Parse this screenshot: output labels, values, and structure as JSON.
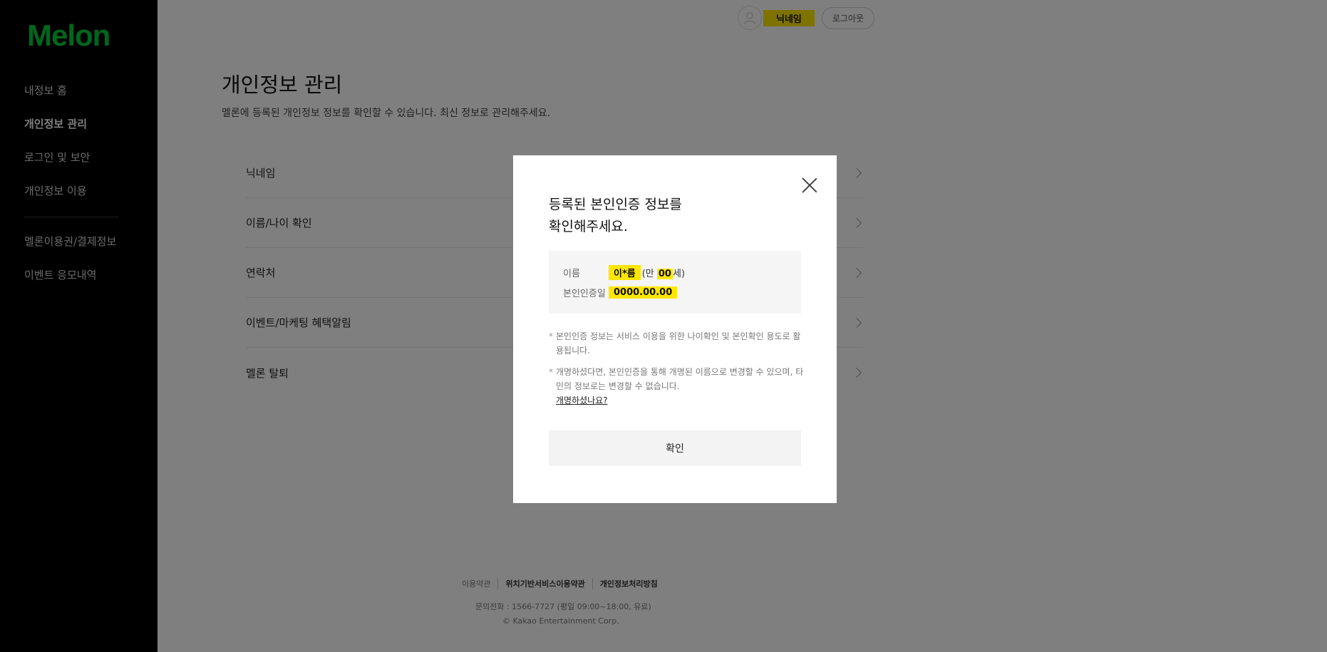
{
  "sidebar": {
    "logo": "Melon",
    "menu": [
      {
        "label": "내정보 홈",
        "active": false
      },
      {
        "label": "개인정보 관리",
        "active": true
      },
      {
        "label": "로그인 및 보안",
        "active": false
      },
      {
        "label": "개인정보 이용",
        "active": false
      }
    ],
    "menu2": [
      {
        "label": "멜론이용권/결제정보"
      },
      {
        "label": "이벤트 응모내역"
      }
    ]
  },
  "header": {
    "nickname": "닉네임",
    "logout_label": "로그아웃"
  },
  "main": {
    "title": "개인정보 관리",
    "description": "멜론에 등록된 개인정보 정보를 확인할 수 있습니다. 최신 정보로 관리해주세요.",
    "rows": [
      {
        "label": "닉네임"
      },
      {
        "label": "이름/나이 확인"
      },
      {
        "label": "연락처"
      },
      {
        "label": "이벤트/마케팅 혜택알림"
      },
      {
        "label": "멜론 탈퇴"
      }
    ]
  },
  "footer": {
    "links": [
      "이용약관",
      "위치기반서비스이용약관",
      "개인정보처리방침"
    ],
    "phone": "문의전화 : 1566-7727 (평일 09:00~18:00, 유료)",
    "copyright": "© Kakao Entertainment Corp."
  },
  "modal": {
    "title_line1": "등록된 본인인증 정보를",
    "title_line2": "확인해주세요.",
    "name_label": "이름",
    "name_value": "이*름",
    "age_prefix": "(만 ",
    "age_value": "00",
    "age_suffix": "세)",
    "date_label": "본인인증일",
    "date_value": "0000.00.00",
    "note1": "본인인증 정보는 서비스 이용을 위한 나이확인 및 본인확인 용도로 활용됩니다.",
    "note2": "개명하셨다면, 본인인증을 통해 개명된 이름으로 변경할 수 있으며, 타인의 정보로는 변경할 수 없습니다.",
    "rename_link": "개명하셨나요?",
    "confirm_label": "확인"
  },
  "colors": {
    "brand": "#00cd3c",
    "highlight": "#ffe600",
    "sidebar_bg": "#000000"
  }
}
